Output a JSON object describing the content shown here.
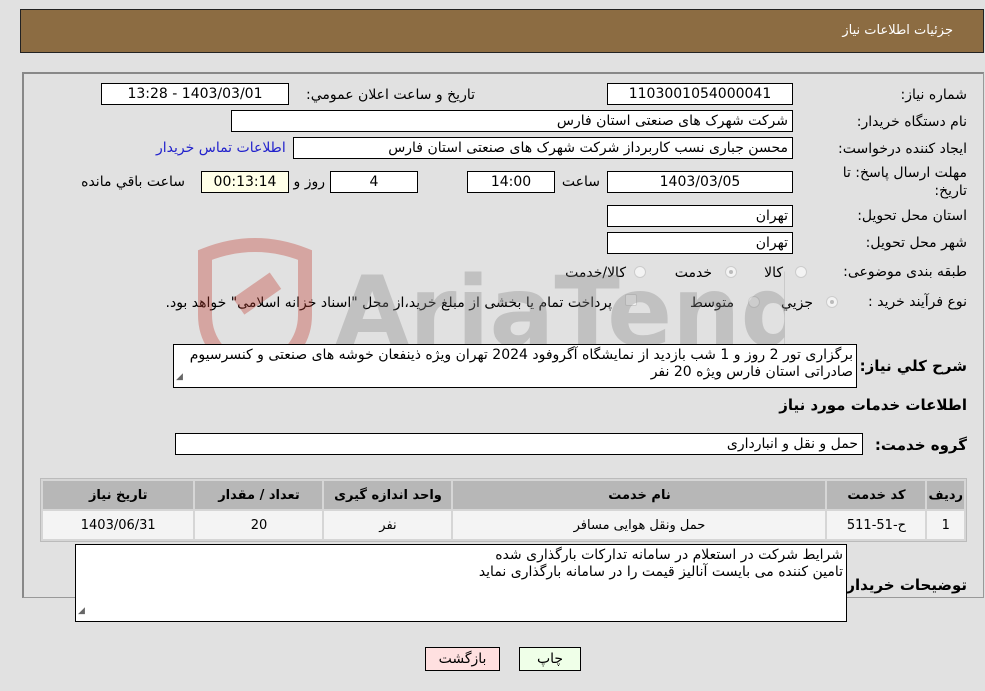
{
  "header": {
    "title": "جزئیات اطلاعات نیاز"
  },
  "form": {
    "need_number_label": "شماره نیاز:",
    "need_number": "1103001054000041",
    "announce_label": "تاریخ و ساعت اعلان عمومي:",
    "announce_value": "1403/03/01 - 13:28",
    "buyer_org_label": "نام دستگاه خریدار:",
    "buyer_org": "شرکت شهرک های صنعتی استان فارس",
    "creator_label": "ایجاد کننده درخواست:",
    "creator": "محسن  جباری نسب کاربرداز شرکت شهرک های صنعتی استان فارس",
    "contact_link": "اطلاعات تماس خریدار",
    "deadline_label_line1": "مهلت ارسال پاسخ: تا",
    "deadline_label_line2": "تاریخ:",
    "deadline_date": "1403/03/05",
    "time_label": "ساعت",
    "deadline_time": "14:00",
    "days_value": "4",
    "days_label": "روز و",
    "remaining_time": "00:13:14",
    "remaining_label": "ساعت باقي مانده",
    "province_label": "استان محل تحویل:",
    "province": "تهران",
    "city_label": "شهر محل تحویل:",
    "city": "تهران",
    "category_label": "طبقه بندی موضوعی:",
    "category_options": [
      "کالا",
      "خدمت",
      "کالا/خدمت"
    ],
    "category_selected": "خدمت",
    "process_label": "نوع فرآیند خرید :",
    "process_options": [
      "جزیي",
      "متوسط"
    ],
    "process_selected": "جزیي",
    "treasury_note": "پرداخت تمام یا بخشی از مبلغ خرید،از محل \"اسناد خزانه اسلامی\" خواهد بود.",
    "description_label": "شرح کلي نیاز:",
    "description": "برگزاری تور 2 روز و 1 شب بازدید از نمایشگاه آگروفود 2024 تهران ویژه ذینفعان خوشه های صنعتی و کنسرسیوم صادراتی استان فارس ویژه 20 نفر",
    "services_heading": "اطلاعات خدمات مورد نیاز",
    "service_group_label": "گروه خدمت:",
    "service_group": "حمل و نقل و انبارداری"
  },
  "table": {
    "headers": [
      "ردیف",
      "کد خدمت",
      "نام خدمت",
      "واحد اندازه گیری",
      "تعداد / مقدار",
      "تاریخ نیاز"
    ],
    "rows": [
      [
        "1",
        "ح-51-511",
        "حمل ونقل هوایی مسافر",
        "نفر",
        "20",
        "1403/06/31"
      ]
    ]
  },
  "buyer_notes": {
    "label": "توضیحات خریدار:",
    "line1": "شرایط شرکت در استعلام در سامانه تداركات بارگذاری شده",
    "line2": "تامین کننده می بایست آنالیز قیمت را در سامانه بارگذاری نماید"
  },
  "buttons": {
    "print": "چاپ",
    "back": "بازگشت"
  },
  "watermark": {
    "text": "AriaTender.neT"
  }
}
